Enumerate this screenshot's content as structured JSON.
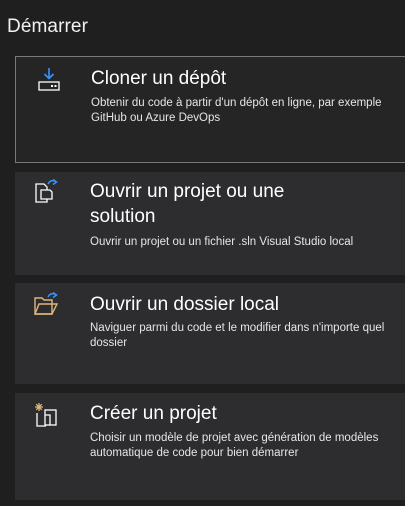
{
  "section": {
    "title": "Démarrer"
  },
  "cards": [
    {
      "title": "Cloner un dépôt",
      "description": "Obtenir du code à partir d'un dépôt en ligne, par exemple GitHub ou Azure DevOps",
      "icon": "clone-repository-icon"
    },
    {
      "title": "Ouvrir un projet ou une solution",
      "description": "Ouvrir un projet ou un fichier .sln Visual Studio local",
      "icon": "open-project-icon"
    },
    {
      "title": "Ouvrir un dossier local",
      "description": "Naviguer parmi du code et le modifier dans n'importe quel dossier",
      "icon": "open-folder-icon"
    },
    {
      "title": "Créer un projet",
      "description": "Choisir un modèle de projet avec génération de modèles automatique de code pour bien démarrer",
      "icon": "new-project-icon"
    }
  ],
  "colors": {
    "background": "#1f1f1f",
    "card": "#2d2d30",
    "accent": "#3794ff",
    "folder": "#dcb67a"
  }
}
